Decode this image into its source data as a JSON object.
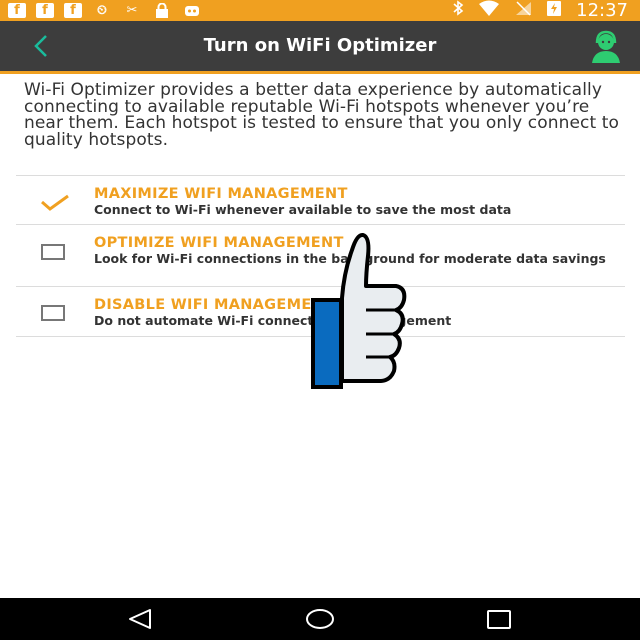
{
  "statusbar": {
    "time": "12:37"
  },
  "appbar": {
    "title": "Turn on WiFi Optimizer"
  },
  "description": "Wi-Fi Optimizer provides a better data experience by automatically connecting to available reputable Wi-Fi hotspots whenever you’re near them. Each hotspot is tested to ensure that you only connect to quality hotspots.",
  "options": [
    {
      "title": "MAXIMIZE WIFI MANAGEMENT",
      "subtitle": "Connect to Wi-Fi whenever available to save the most data",
      "selected": true
    },
    {
      "title": "OPTIMIZE WIFI MANAGEMENT",
      "subtitle": "Look for Wi-Fi connections in the background for moderate data savings",
      "selected": false
    },
    {
      "title": "DISABLE WIFI MANAGEMENT",
      "subtitle": "Do not automate Wi-Fi connection or management",
      "selected": false
    }
  ],
  "colors": {
    "accent": "#f0a020",
    "appbar": "#3d3d3d",
    "back_arrow": "#1abc9c",
    "thumb_cuff": "#0a6bbf"
  },
  "icons": {
    "status_left": [
      "facebook-icon",
      "facebook-icon",
      "facebook-icon",
      "alarm-icon",
      "tools-icon",
      "lock-icon",
      "robot-icon"
    ],
    "status_right": [
      "bluetooth-icon",
      "wifi-icon",
      "no-sim-icon",
      "battery-charging-icon"
    ],
    "nav": [
      "back-icon",
      "home-icon",
      "recents-icon"
    ]
  }
}
